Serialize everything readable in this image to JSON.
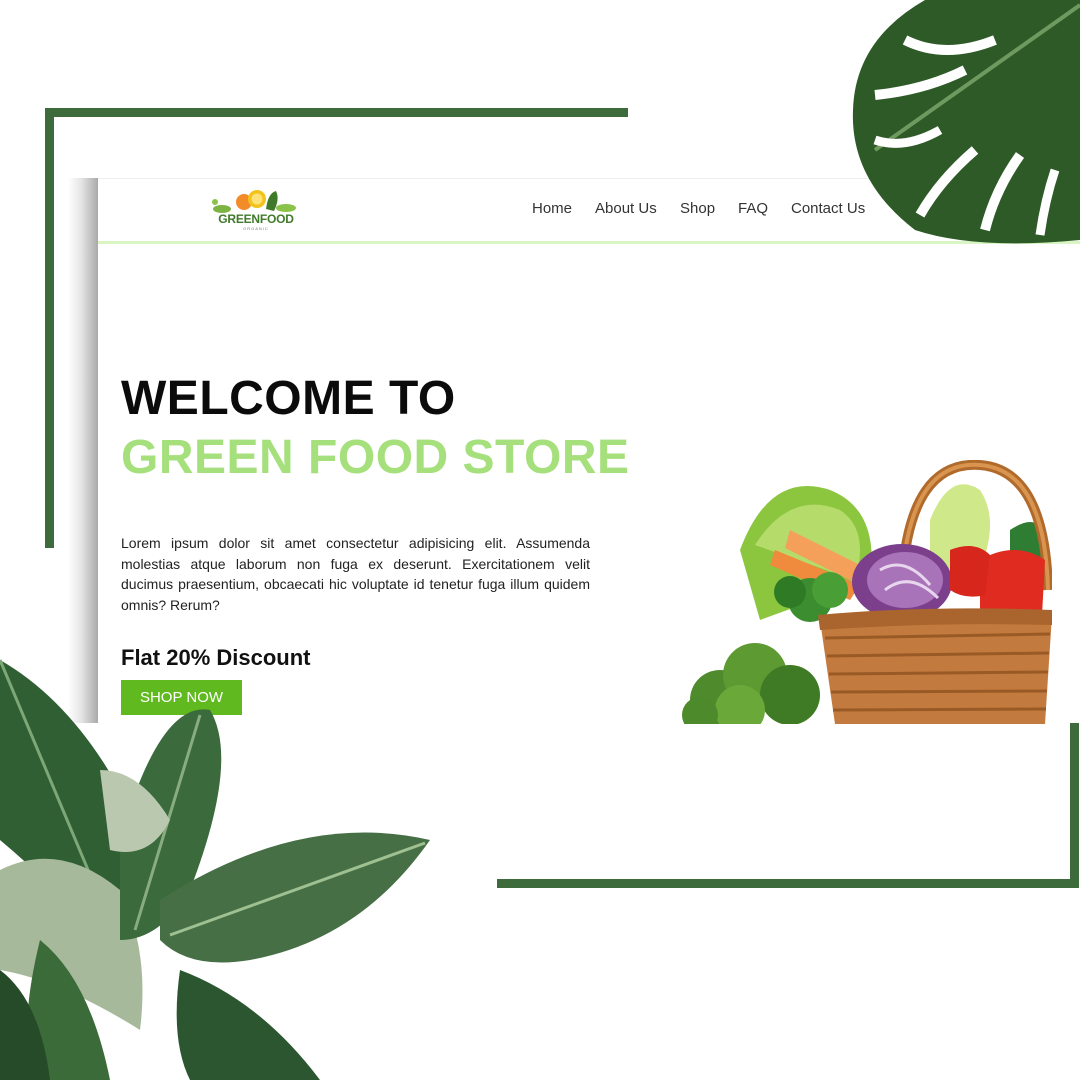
{
  "brand": {
    "name": "GREENFOOD",
    "tagline": "ORGANIC"
  },
  "nav": {
    "items": [
      {
        "label": "Home"
      },
      {
        "label": "About Us"
      },
      {
        "label": "Shop"
      },
      {
        "label": "FAQ"
      },
      {
        "label": "Contact Us"
      }
    ]
  },
  "hero": {
    "title_line1": "WELCOME TO",
    "title_line2": "GREEN FOOD STORE",
    "description": "Lorem ipsum dolor sit amet consectetur adipisicing elit. Assumenda molestias atque laborum non fuga ex deserunt. Exercitationem velit ducimus praesentium, obcaecati hic voluptate id tenetur fuga illum quidem omnis? Rerum?",
    "discount": "Flat 20% Discount",
    "cta_label": "SHOP NOW"
  },
  "colors": {
    "frame": "#3e6b3b",
    "accent_green": "#a6e07d",
    "button_green": "#5fb91f",
    "nav_underline": "#d9f5c4"
  },
  "icons": {
    "basket": "vegetable-basket-image",
    "plant_top": "monstera-leaf-image",
    "plant_bottom": "banana-leaf-plant-image"
  }
}
